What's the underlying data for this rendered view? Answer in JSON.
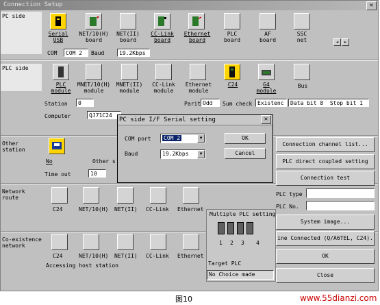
{
  "window": {
    "title": "Connection Setup",
    "close": "✕"
  },
  "sections": {
    "pc_side": "PC side",
    "plc_side": "PLC side",
    "other_station": "Other station",
    "network_route": "Network route",
    "coexistence_network": "Co-existence network"
  },
  "pc_side_items": [
    {
      "label": "Serial\nUSB"
    },
    {
      "label": "NET/10(H)\nboard"
    },
    {
      "label": "NET(II)\nboard"
    },
    {
      "label": "CC-Link\nboard"
    },
    {
      "label": "Ethernet\nboard"
    },
    {
      "label": "PLC\nboard"
    },
    {
      "label": "AF\nboard"
    },
    {
      "label": "SSC\nnet"
    }
  ],
  "pc_scroll": {
    "left": "◄",
    "right": "►"
  },
  "com_row": {
    "com_label": "COM",
    "com_value": "COM 2",
    "baud_label": "Baud",
    "baud_value": "19.2Kbps"
  },
  "plc_side_items": [
    {
      "label": "PLC\nmodule"
    },
    {
      "label": "MNET/10(H)\nmodule"
    },
    {
      "label": "MNET(II)\nmodule"
    },
    {
      "label": "CC-Link\nmodule"
    },
    {
      "label": "Ethernet\nmodule"
    },
    {
      "label": "C24"
    },
    {
      "label": "G4\nmodule"
    },
    {
      "label": "Bus"
    }
  ],
  "station_row": {
    "station_label": "Station",
    "station_value": "0",
    "parity_label": "Parit",
    "parity_value": "Odd",
    "sum_label": "Sum check",
    "sum_value": "Existenc",
    "data_bits": "Data bit 8",
    "stop_bits": "Stop bit 1"
  },
  "computer_row": {
    "label": "Computer",
    "value": "QJ71C24"
  },
  "other_station": {
    "no_label": "No",
    "other_label": "Other s",
    "timeout_label": "Time out",
    "timeout_value": "10"
  },
  "network_route_items": [
    "C24",
    "NET/10(H)",
    "NET(II)",
    "CC-Link",
    "Ethernet"
  ],
  "coexist_items": [
    "C24",
    "NET/10(H)",
    "NET(II)",
    "CC-Link",
    "Ethernet"
  ],
  "status_text": "Accessing host station",
  "multiple_plc": {
    "title": "Multiple PLC setting",
    "nums": [
      "1",
      "2",
      "3",
      "4"
    ],
    "target_label": "Target PLC",
    "target_value": "No Choice made"
  },
  "right_buttons": {
    "conn_channel": "Connection channel list...",
    "plc_direct": "PLC direct coupled setting",
    "conn_test": "Connection test",
    "plc_type_label": "PLC type",
    "plc_no_label": "PLC No.",
    "system_image": "System image...",
    "line_connected": "ine Connected (Q/A6TEL, C24).",
    "ok": "OK",
    "close": "Close"
  },
  "dialog": {
    "title": "PC side I/F  Serial setting",
    "close": "✕",
    "com_port_label": "COM port",
    "com_port_value": "COM 2",
    "baud_label": "Baud",
    "baud_value": "19.2Kbps",
    "ok": "OK",
    "cancel": "Cancel"
  },
  "caption": {
    "figure": "图10",
    "watermark": "www.55dianzi.com"
  }
}
